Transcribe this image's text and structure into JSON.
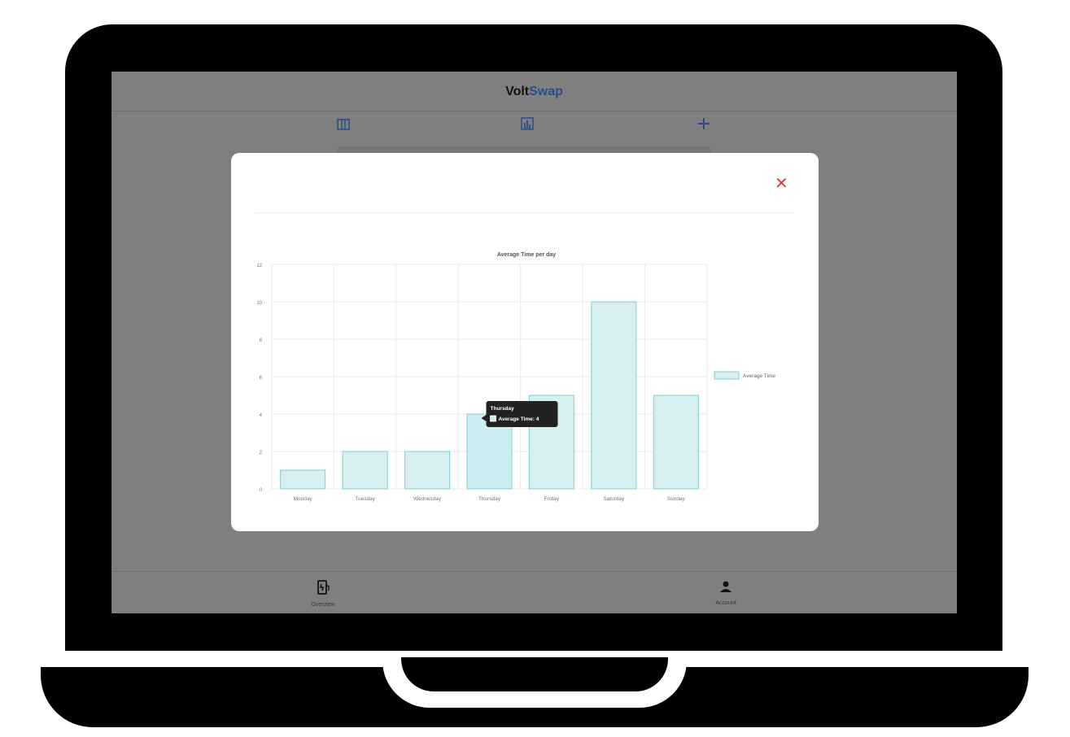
{
  "app": {
    "brand_part1": "Volt",
    "brand_part2": "Swap",
    "tab_icons": [
      "map-icon",
      "bar-chart-icon",
      "plus-icon"
    ]
  },
  "bottom_nav": [
    {
      "label": "Overview",
      "icon": "ev-station-icon"
    },
    {
      "label": "Account",
      "icon": "person-icon"
    }
  ],
  "modal": {
    "close_label": "✕"
  },
  "chart_data": {
    "type": "bar",
    "title": "Average Time per day",
    "categories": [
      "Monday",
      "Tuesday",
      "Wednesday",
      "Thursday",
      "Friday",
      "Saturday",
      "Sunday"
    ],
    "series": [
      {
        "name": "Average Time",
        "values": [
          1,
          2,
          2,
          4,
          5,
          10,
          5
        ]
      }
    ],
    "ylim": [
      0,
      12
    ],
    "yticks": [
      0,
      2,
      4,
      6,
      8,
      10,
      12
    ],
    "grid": true,
    "legend": "right",
    "colors": {
      "bar_fill": "#d7eff1",
      "bar_stroke": "#7fcfd4",
      "hover_fill": "#cdeef2"
    },
    "tooltip": {
      "title": "Thursday",
      "text": "Average Time: 4"
    }
  }
}
